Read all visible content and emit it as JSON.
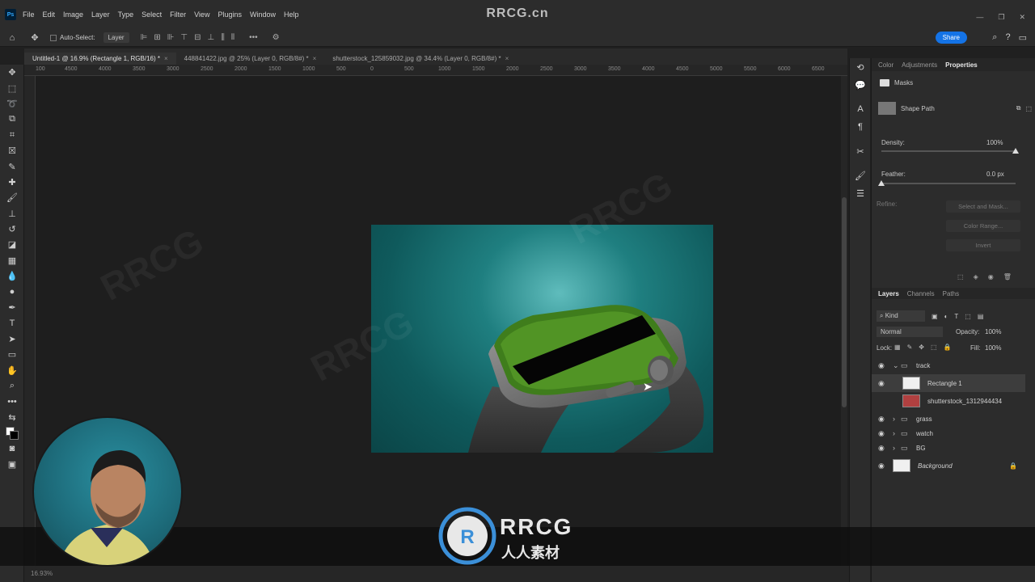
{
  "brand_watermark": "RRCG.cn",
  "menu": {
    "logo": "Ps",
    "items": [
      "File",
      "Edit",
      "Image",
      "Layer",
      "Type",
      "Select",
      "Filter",
      "View",
      "Plugins",
      "Window",
      "Help"
    ]
  },
  "options_bar": {
    "auto_select_label": "Auto-Select:",
    "layer_select_value": "Layer",
    "share_label": "Share"
  },
  "doc_tabs": [
    {
      "label": "Untitled-1 @ 16.9% (Rectangle 1, RGB/16) *",
      "active": true
    },
    {
      "label": "448841422.jpg @ 25% (Layer 0, RGB/8#) *",
      "active": false
    },
    {
      "label": "shutterstock_125859032.jpg @ 34.4% (Layer 0, RGB/8#) *",
      "active": false
    }
  ],
  "ruler_labels": [
    "100",
    "4500",
    "4000",
    "3500",
    "3000",
    "2500",
    "2000",
    "1500",
    "1000",
    "500",
    "0",
    "500",
    "1000",
    "1500",
    "2000",
    "2500",
    "3000",
    "3500",
    "4000",
    "4500",
    "5000",
    "5500",
    "6000",
    "6500"
  ],
  "properties_panel": {
    "tabs": [
      "Color",
      "Adjustments",
      "Properties"
    ],
    "section": "Masks",
    "shape_path_label": "Shape Path",
    "density_label": "Density:",
    "density_value": "100%",
    "density_level": 1.0,
    "feather_label": "Feather:",
    "feather_value": "0.0 px",
    "refine_label": "Refine:",
    "select_and_mask": "Select and Mask...",
    "color_range": "Color Range...",
    "invert": "Invert"
  },
  "layers_panel": {
    "tabs": [
      "Layers",
      "Channels",
      "Paths"
    ],
    "filter_kind": "Kind",
    "blend_mode": "Normal",
    "opacity_label": "Opacity:",
    "opacity_value": "100%",
    "lock_label": "Lock:",
    "fill_label": "Fill:",
    "fill_value": "100%",
    "layers": [
      {
        "name": "track",
        "kind": "group-open",
        "visible": true
      },
      {
        "name": "Rectangle 1",
        "kind": "shape",
        "visible": true,
        "selected": true
      },
      {
        "name": "shutterstock_1312944434",
        "kind": "image",
        "visible": false
      },
      {
        "name": "grass",
        "kind": "group",
        "visible": true
      },
      {
        "name": "watch",
        "kind": "group",
        "visible": true
      },
      {
        "name": "BG",
        "kind": "group",
        "visible": true
      },
      {
        "name": "Background",
        "kind": "background",
        "visible": true,
        "locked": true
      }
    ]
  },
  "overlay_logo": {
    "main": "RRCG",
    "sub": "人人素材"
  },
  "status_text": "16.93%",
  "colors": {
    "accent": "#1473e6",
    "panel": "#2c2c2c",
    "canvas_bg": "#1e1e1e",
    "doc_bg": "#0f5a5c"
  }
}
